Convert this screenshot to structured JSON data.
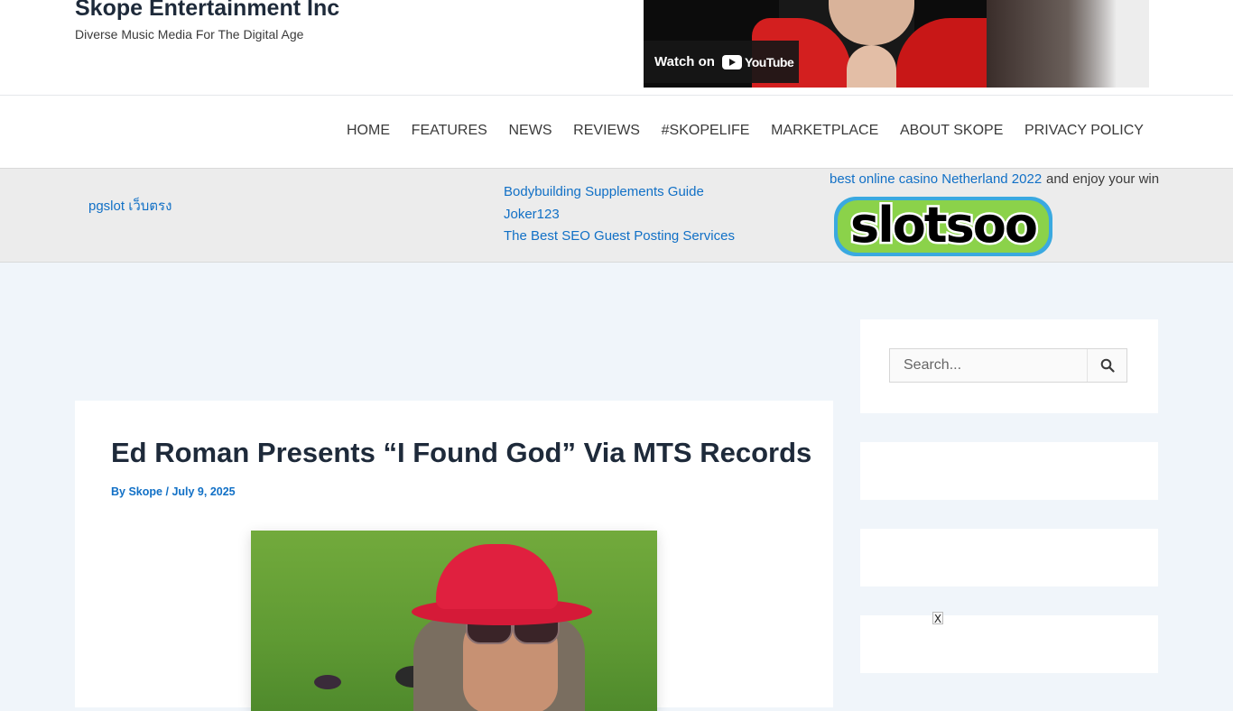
{
  "site": {
    "title": "Skope Entertainment Inc",
    "tagline": "Diverse Music Media For The Digital Age"
  },
  "video": {
    "watch_on": "Watch on",
    "youtube_label": "YouTube"
  },
  "nav": {
    "items": [
      {
        "label": "HOME"
      },
      {
        "label": "FEATURES"
      },
      {
        "label": "NEWS"
      },
      {
        "label": "REVIEWS"
      },
      {
        "label": "#SKOPELIFE"
      },
      {
        "label": "MARKETPLACE"
      },
      {
        "label": "ABOUT SKOPE"
      },
      {
        "label": "PRIVACY POLICY"
      }
    ]
  },
  "ads": {
    "left_link": "pgslot เว็บตรง",
    "middle_links": [
      "Bodybuilding Supplements Guide",
      "Joker123",
      "The Best SEO Guest Posting Services"
    ],
    "casino_link": "best online casino Netherland 2022",
    "casino_suffix": "and enjoy your win",
    "slotsoo_logo_text": "slotsoo"
  },
  "post": {
    "title": "Ed Roman Presents “I Found God” Via MTS Records",
    "meta_by": "By",
    "author": "Skope",
    "separator": "/",
    "date": "July 9, 2025"
  },
  "sidebar": {
    "search_placeholder": "Search..."
  },
  "overlay": {
    "close_label": "X"
  },
  "colors": {
    "link": "#1170c6",
    "heading": "#1e2a3a",
    "page_bg": "#f0f5fa",
    "ad_bg": "#ececec"
  }
}
